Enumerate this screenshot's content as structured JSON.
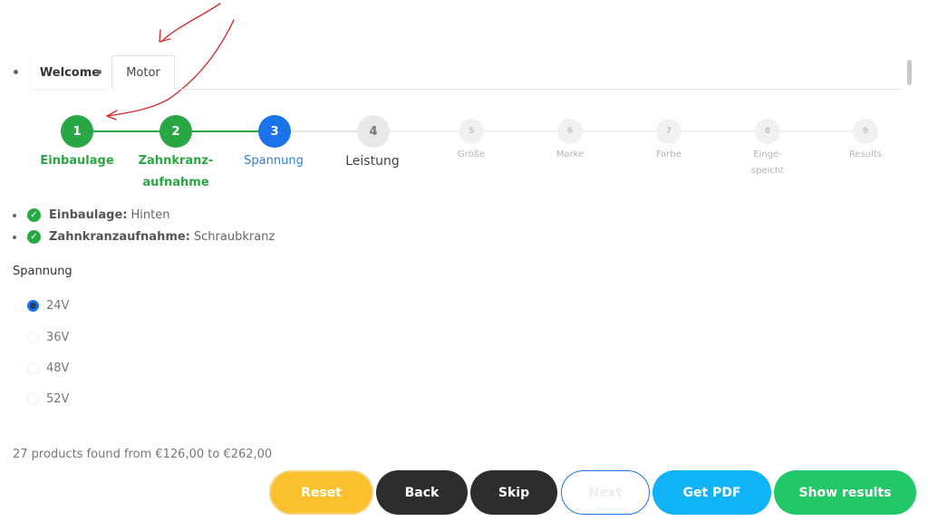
{
  "tabs": [
    {
      "label": "Welcome"
    },
    {
      "label": "Motor"
    }
  ],
  "steps": [
    {
      "number": "1",
      "label": "Einbaulage"
    },
    {
      "number": "2",
      "label_line1": "Zahnkranz-",
      "label_line2": "aufnahme"
    },
    {
      "number": "3",
      "label": "Spannung"
    },
    {
      "number": "4",
      "label": "Leistung"
    },
    {
      "number": "5",
      "label": "Größe"
    },
    {
      "number": "6",
      "label": "Marke"
    },
    {
      "number": "7",
      "label": "Farbe"
    },
    {
      "number": "8",
      "label_line1": "Einge-",
      "label_line2": "speicht"
    },
    {
      "number": "9",
      "label": "Results"
    }
  ],
  "summary": [
    {
      "key": "Einbaulage:",
      "value": "Hinten"
    },
    {
      "key": "Zahnkranzaufnahme:",
      "value": "Schraubkranz"
    }
  ],
  "question": {
    "title": "Spannung",
    "options": [
      "24V",
      "36V",
      "48V",
      "52V"
    ],
    "selected": "24V"
  },
  "products_text": "27 products found from €126,00 to €262,00",
  "buttons": {
    "reset": "Reset",
    "back": "Back",
    "skip": "Skip",
    "next": "Next",
    "pdf": "Get PDF",
    "results": "Show results"
  },
  "colors": {
    "done": "#2aa745",
    "current": "#1a73e8",
    "reset": "#fbc02d",
    "dark": "#2d2d2d",
    "pdf": "#10b3f5",
    "results": "#22c868",
    "annotation": "#d32f2f"
  }
}
